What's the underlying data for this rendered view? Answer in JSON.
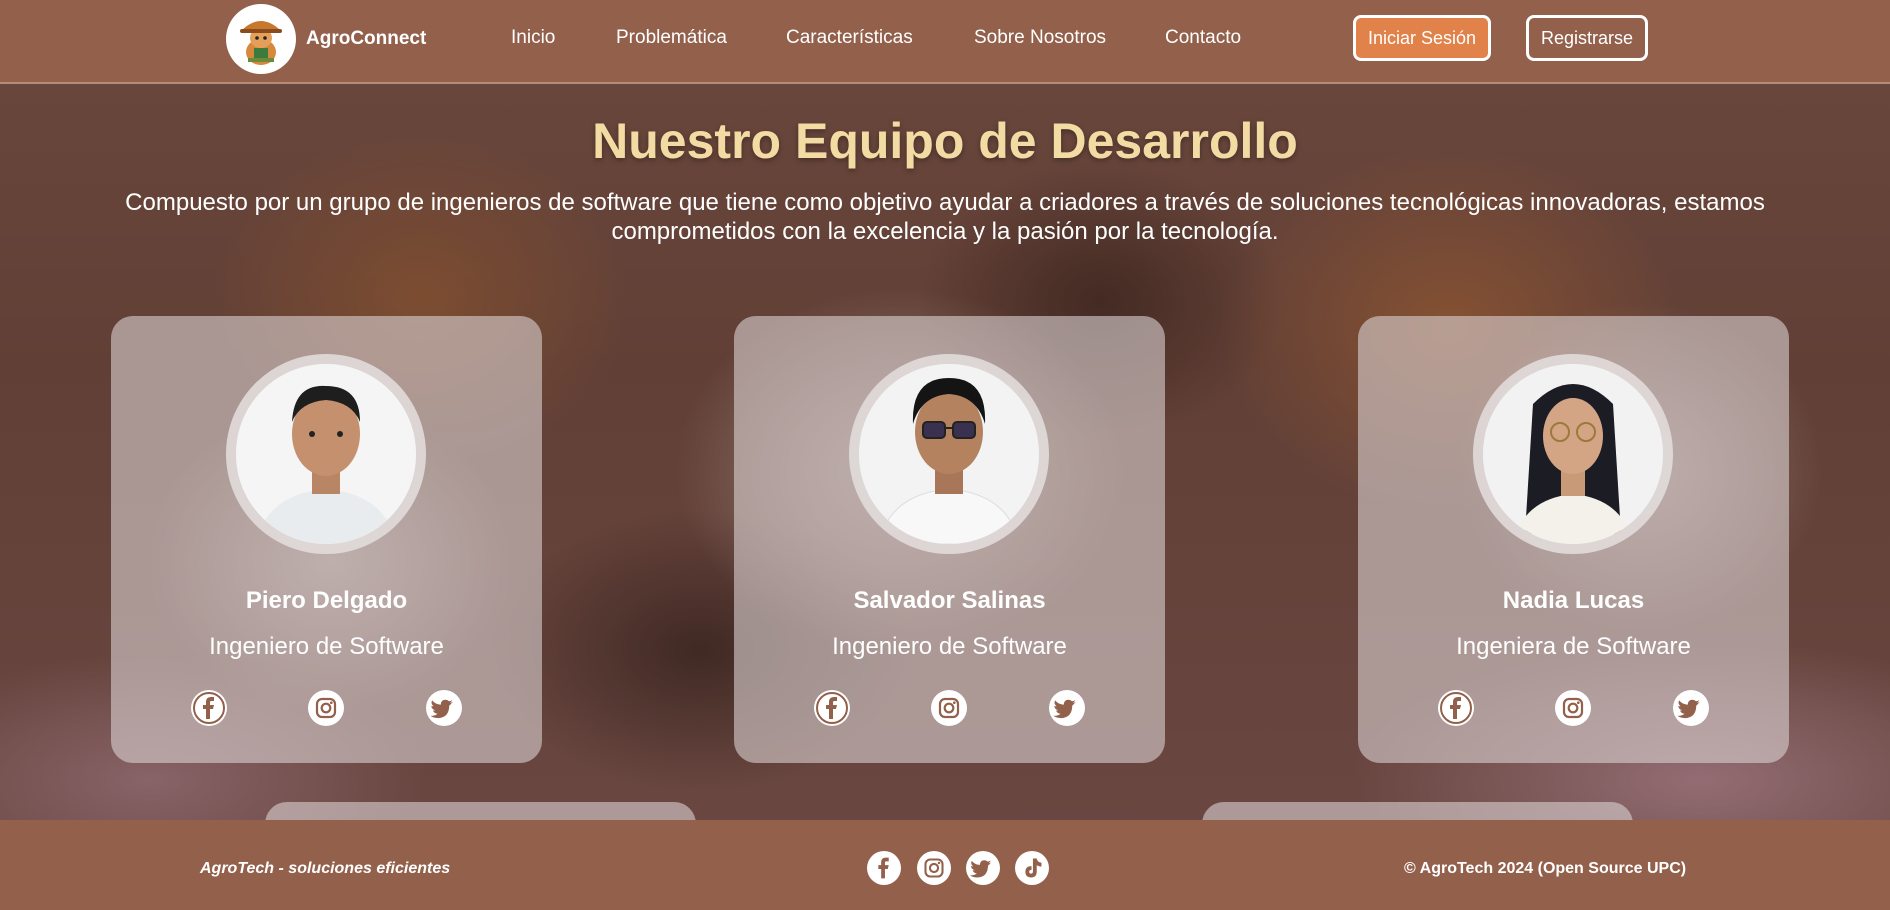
{
  "header": {
    "brand": "AgroConnect",
    "logo_icon": "guinea-pig-farmer-logo",
    "nav": [
      "Inicio",
      "Problemática",
      "Características",
      "Sobre Nosotros",
      "Contacto"
    ],
    "login_label": "Iniciar Sesión",
    "register_label": "Registrarse"
  },
  "hero": {
    "title": "Nuestro Equipo de Desarrollo",
    "subtitle": "Compuesto por un grupo de ingenieros de software que tiene como objetivo ayudar a criadores a través de soluciones tecnológicas innovadoras, estamos comprometidos con la excelencia y la pasión por la tecnología."
  },
  "team": [
    {
      "name": "Piero Delgado",
      "role": "Ingeniero de Software"
    },
    {
      "name": "Salvador Salinas",
      "role": "Ingeniero de Software"
    },
    {
      "name": "Nadia Lucas",
      "role": "Ingeniera de Software"
    }
  ],
  "social_icons": [
    "facebook-icon",
    "instagram-icon",
    "twitter-icon"
  ],
  "footer": {
    "tagline": "AgroTech - soluciones eficientes",
    "copyright": "© AgroTech 2024 (Open Source UPC)",
    "icons": [
      "facebook-icon",
      "instagram-icon",
      "twitter-icon",
      "tiktok-icon"
    ]
  },
  "colors": {
    "header_bg": "#93604c",
    "accent": "#e0824a",
    "title": "#f2dca3",
    "icon": "#93604c"
  }
}
